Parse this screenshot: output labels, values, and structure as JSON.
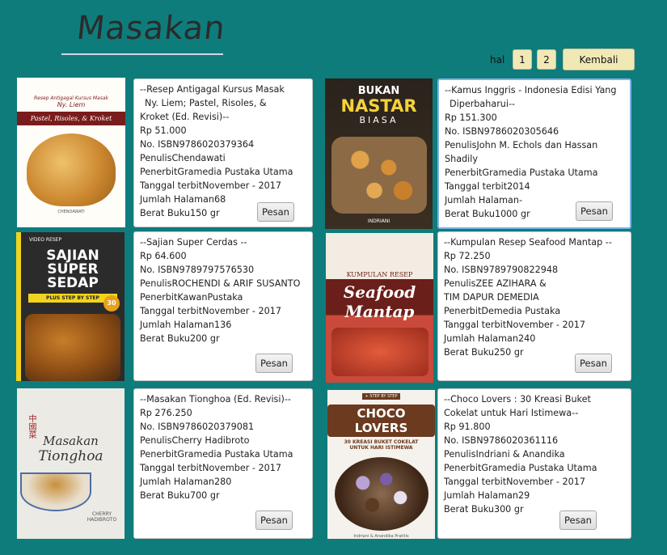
{
  "header": {
    "title": "Masakan"
  },
  "pager": {
    "label": "hal",
    "pages": [
      "1",
      "2"
    ],
    "back": "Kembali"
  },
  "books": [
    {
      "lines": [
        "--Resep Antigagal Kursus Masak",
        "Ny. Liem; Pastel, Risoles, &",
        "Kroket (Ed. Revisi)--",
        "Rp 51.000",
        "No. ISBN9786020379364",
        "PenulisChendawati",
        "PenerbitGramedia Pustaka Utama",
        "Tanggal terbitNovember - 2017",
        "Jumlah Halaman68",
        "Berat Buku150 gr"
      ],
      "order": "Pesan",
      "cover": {
        "top": "Resep Antigagal Kursus Masak",
        "mid": "Ny. Liem",
        "band": "Pastel, Risoles, & Kroket",
        "bottom": "CHENDAWATI"
      }
    },
    {
      "lines": [
        "--Kamus Inggris - Indonesia Edisi Yang",
        "Diperbaharui--",
        "Rp 151.300",
        "No. ISBN9786020305646",
        "PenulisJohn M. Echols dan Hassan",
        "Shadily",
        "PenerbitGramedia Pustaka Utama",
        "Tanggal terbit2014",
        "Jumlah Halaman-",
        "Berat Buku1000 gr"
      ],
      "order": "Pesan",
      "cover": {
        "top": "BUKAN",
        "mid": "NASTAR",
        "band": "BIASA",
        "bottom": "INDRIANI"
      }
    },
    {
      "lines": [
        "--Sajian Super Cerdas --",
        "Rp 64.600",
        "No. ISBN9789797576530",
        "PenulisROCHENDI & ARIF SUSANTO",
        "PenerbitKawanPustaka",
        "Tanggal terbitNovember - 2017",
        "Jumlah Halaman136",
        "Berat Buku200 gr"
      ],
      "order": "Pesan",
      "cover": {
        "top": "VIDEO RESEP",
        "mid": "SAJIAN SUPER SEDAP",
        "band": "PLUS STEP BY STEP",
        "bottom": "30"
      }
    },
    {
      "lines": [
        "--Kumpulan Resep Seafood Mantap --",
        "Rp 72.250",
        "No. ISBN9789790822948",
        "PenulisZEE AZIHARA &",
        "TIM DAPUR DEMEDIA",
        "PenerbitDemedia Pustaka",
        "Tanggal terbitNovember - 2017",
        "Jumlah Halaman240",
        "Berat Buku250 gr"
      ],
      "order": "Pesan",
      "cover": {
        "top": "KUMPULAN RESEP",
        "mid": "Seafood",
        "band": "Mantap",
        "bottom": ""
      }
    },
    {
      "lines": [
        "--Masakan Tionghoa (Ed. Revisi)--",
        "Rp 276.250",
        "No. ISBN9786020379081",
        "PenulisCherry Hadibroto",
        "PenerbitGramedia Pustaka Utama",
        "Tanggal terbitNovember - 2017",
        "Jumlah Halaman280",
        "Berat Buku700 gr"
      ],
      "order": "Pesan",
      "cover": {
        "top": "中國菜",
        "mid": "Masakan",
        "band": "Tionghoa",
        "bottom": "CHERRY HADIBROTO"
      }
    },
    {
      "lines": [
        "--Choco Lovers : 30 Kreasi Buket",
        "Cokelat untuk Hari Istimewa--",
        "Rp 91.800",
        "No. ISBN9786020361116",
        "PenulisIndriani & Anandika",
        "PenerbitGramedia Pustaka Utama",
        "Tanggal terbitNovember - 2017",
        "Jumlah Halaman29",
        "Berat Buku300 gr"
      ],
      "order": "Pesan",
      "cover": {
        "top": "+ STEP BY STEP",
        "mid": "CHOCO LOVERS",
        "band": "30 KREASI BUKET COKELAT UNTUK HARI ISTIMEWA",
        "bottom": "Indriani & Anandika Pratitis"
      }
    }
  ]
}
